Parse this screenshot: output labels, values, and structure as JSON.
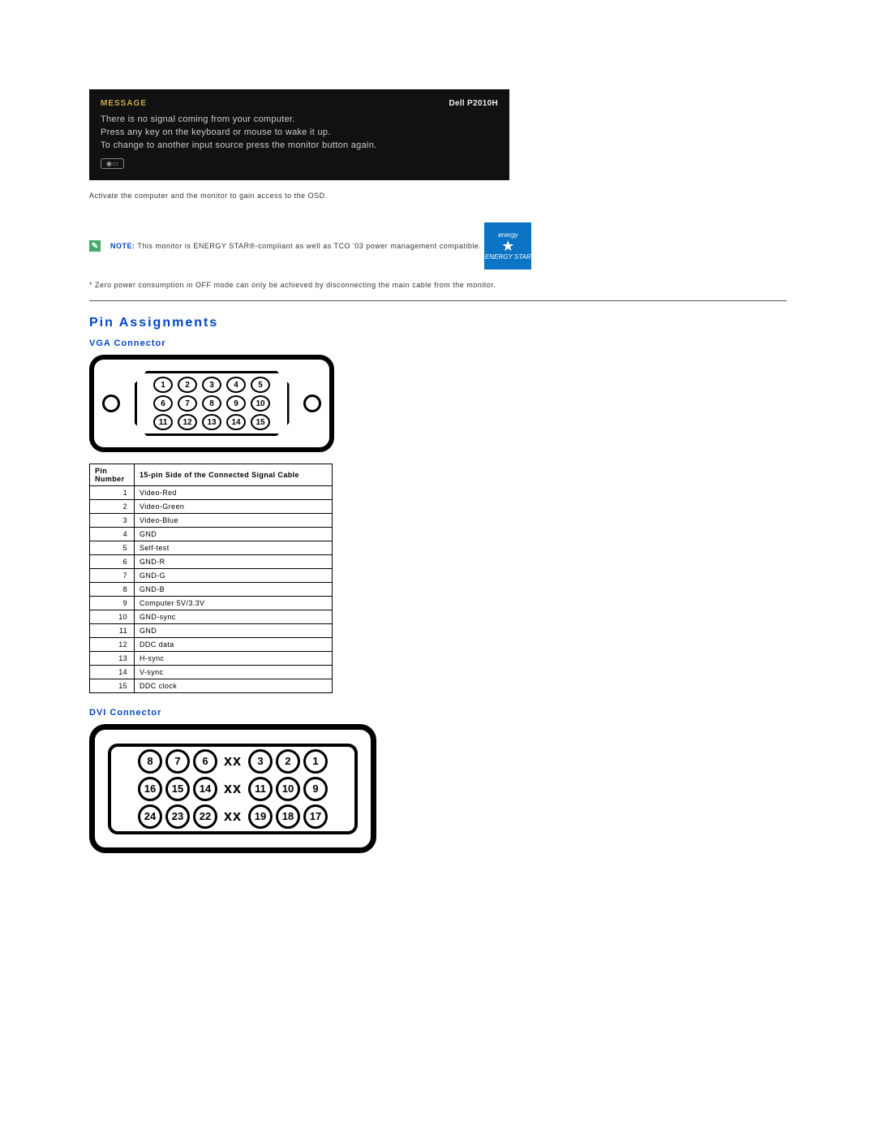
{
  "osd": {
    "message_label": "MESSAGE",
    "model": "Dell   P2010H",
    "line1": "There is no signal coming from your computer.",
    "line2": "Press any key on the keyboard or mouse to wake it up.",
    "line3": "To change to another input source press the monitor button again.",
    "icon_text": "◉▭"
  },
  "body": {
    "activate_text": "Activate the computer and the monitor to gain access to the OSD.",
    "note_label": "NOTE:",
    "note_text": " This monitor is ENERGY STAR®-compliant as well as TCO '03 power management compatible.",
    "estar_top": "energy",
    "estar_bottom": "ENERGY STAR",
    "footnote": "* Zero power consumption in OFF mode can only be achieved by disconnecting the main cable from the monitor."
  },
  "sections": {
    "pin_assignments": "Pin Assignments",
    "vga_connector": "VGA Connector",
    "dvi_connector": "DVI Connector"
  },
  "vga_table": {
    "header_pin": "Pin Number",
    "header_desc": "15-pin Side of the Connected Signal Cable",
    "rows": [
      {
        "n": "1",
        "d": "Video-Red"
      },
      {
        "n": "2",
        "d": "Video-Green"
      },
      {
        "n": "3",
        "d": "Video-Blue"
      },
      {
        "n": "4",
        "d": "GND"
      },
      {
        "n": "5",
        "d": "Self-test"
      },
      {
        "n": "6",
        "d": "GND-R"
      },
      {
        "n": "7",
        "d": "GND-G"
      },
      {
        "n": "8",
        "d": "GND-B"
      },
      {
        "n": "9",
        "d": "Computer 5V/3.3V"
      },
      {
        "n": "10",
        "d": "GND-sync"
      },
      {
        "n": "11",
        "d": "GND"
      },
      {
        "n": "12",
        "d": "DDC data"
      },
      {
        "n": "13",
        "d": "H-sync"
      },
      {
        "n": "14",
        "d": "V-sync"
      },
      {
        "n": "15",
        "d": "DDC clock"
      }
    ]
  },
  "vga_pins": {
    "row1": [
      "1",
      "2",
      "3",
      "4",
      "5"
    ],
    "row2": [
      "6",
      "7",
      "8",
      "9",
      "10"
    ],
    "row3": [
      "11",
      "12",
      "13",
      "14",
      "15"
    ]
  },
  "dvi_pins": {
    "row1_left": [
      "8",
      "7",
      "6"
    ],
    "row1_right": [
      "3",
      "2",
      "1"
    ],
    "row2_left": [
      "16",
      "15",
      "14"
    ],
    "row2_right": [
      "11",
      "10",
      "9"
    ],
    "row3_left": [
      "24",
      "23",
      "22"
    ],
    "row3_right": [
      "19",
      "18",
      "17"
    ],
    "gap": "xx"
  }
}
